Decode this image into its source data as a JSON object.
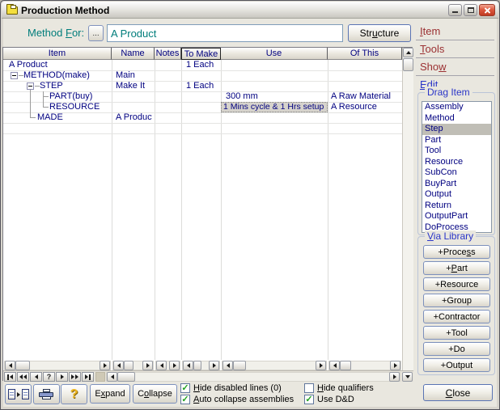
{
  "window": {
    "title": "Production Method"
  },
  "header": {
    "method_for_label": "Method For:",
    "browse_button": "...",
    "method_value": "A Product",
    "structure_button": "Structure"
  },
  "grid": {
    "columns": [
      "Item",
      "Name",
      "Notes",
      "To Make",
      "Use",
      "Of This"
    ],
    "rows": [
      {
        "item": "A Product",
        "name": "",
        "notes": "",
        "to_make": "1 Each",
        "use": "",
        "of_this": ""
      },
      {
        "item": "METHOD(make)",
        "name": "Main",
        "notes": "",
        "to_make": "",
        "use": "",
        "of_this": ""
      },
      {
        "item": "STEP",
        "name": "Make It",
        "notes": "",
        "to_make": "1 Each",
        "use": "",
        "of_this": ""
      },
      {
        "item": "PART(buy)",
        "name": "",
        "notes": "",
        "to_make": "",
        "use": "300 mm",
        "of_this": "A Raw Material"
      },
      {
        "item": "RESOURCE",
        "name": "",
        "notes": "",
        "to_make": "",
        "use": "1 Mins cycle & 1 Hrs setup",
        "of_this": "A Resource"
      },
      {
        "item": "MADE",
        "name": "A Product",
        "notes": "",
        "to_make": "",
        "use": "",
        "of_this": ""
      }
    ],
    "navigator_help": "?"
  },
  "footer": {
    "expand_button": "Expand",
    "collapse_button": "Collapse",
    "help_button": "?",
    "checkboxes": [
      {
        "label": "Hide disabled lines (0)",
        "mark": "✓"
      },
      {
        "label": "Auto collapse assemblies",
        "mark": "✓"
      },
      {
        "label": "Hide qualifiers",
        "mark": ""
      },
      {
        "label": "Use D&D",
        "mark": "✓"
      }
    ]
  },
  "right_panel": {
    "tabs": [
      {
        "label": "Item"
      },
      {
        "label": "Tools"
      },
      {
        "label": "Show"
      },
      {
        "label": "Edit"
      }
    ],
    "drag_item": {
      "title": "Drag Item",
      "items": [
        "Assembly",
        "Method",
        "Step",
        "Part",
        "Tool",
        "Resource",
        "SubCon",
        "BuyPart",
        "Output",
        "Return",
        "OutputPart",
        "DoProcess"
      ],
      "selected": "Step"
    },
    "via_library": {
      "title": "Via Library",
      "buttons": [
        "+Process",
        "+Part",
        "+Resource",
        "+Group",
        "+Contractor",
        "+Tool",
        "+Do",
        "+Output"
      ]
    },
    "close_button": "Close"
  },
  "colors": {
    "teal_accent": "#007d7b",
    "grid_text": "#000080",
    "tab_maroon": "#9b3032",
    "tab_blue": "#2a35c8",
    "check_green": "#1fa11f",
    "selection_gray": "#d6d3cc"
  }
}
